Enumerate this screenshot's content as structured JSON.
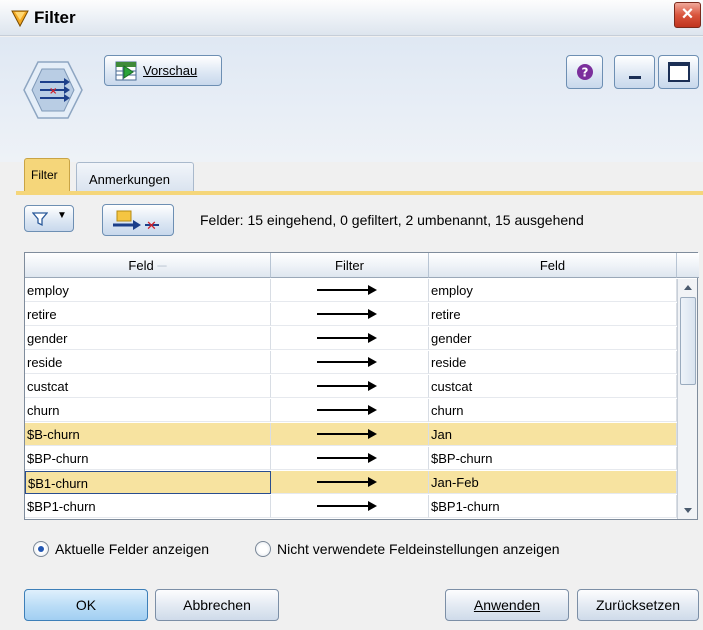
{
  "window": {
    "title": "Filter"
  },
  "toolbar": {
    "preview_label": "Vorschau"
  },
  "tabs": [
    {
      "label": "Filter",
      "active": true
    },
    {
      "label": "Anmerkungen",
      "active": false
    }
  ],
  "summary": "Felder: 15 eingehend, 0 gefiltert, 2 umbenannt, 15 ausgehend",
  "table": {
    "headers": [
      "Feld",
      "Filter",
      "Feld"
    ],
    "rows": [
      {
        "input": "employ",
        "output": "employ",
        "highlighted": false
      },
      {
        "input": "retire",
        "output": "retire",
        "highlighted": false
      },
      {
        "input": "gender",
        "output": "gender",
        "highlighted": false
      },
      {
        "input": "reside",
        "output": "reside",
        "highlighted": false
      },
      {
        "input": "custcat",
        "output": "custcat",
        "highlighted": false
      },
      {
        "input": "churn",
        "output": "churn",
        "highlighted": false
      },
      {
        "input": "$B-churn",
        "output": "Jan",
        "highlighted": true
      },
      {
        "input": "$BP-churn",
        "output": "$BP-churn",
        "highlighted": false
      },
      {
        "input": "$B1-churn",
        "output": "Jan-Feb",
        "highlighted": true,
        "selected": true
      },
      {
        "input": "$BP1-churn",
        "output": "$BP1-churn",
        "highlighted": false
      }
    ]
  },
  "options": {
    "show_current": "Aktuelle Felder anzeigen",
    "show_unused": "Nicht verwendete Feldeinstellungen anzeigen",
    "selected": "show_current"
  },
  "buttons": {
    "ok": "OK",
    "cancel": "Abbrechen",
    "apply": "Anwenden",
    "reset": "Zurücksetzen"
  },
  "colors": {
    "highlight_row": "#f7e3a0",
    "active_tab": "#f5d67a",
    "close": "#d9553d"
  }
}
